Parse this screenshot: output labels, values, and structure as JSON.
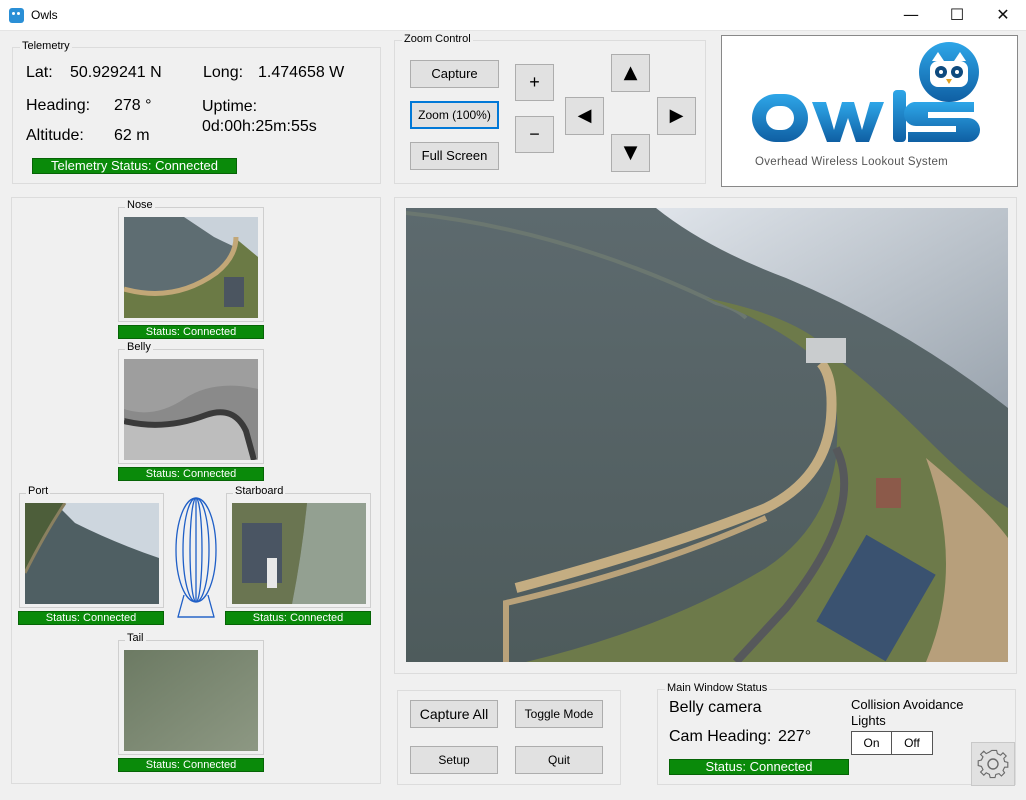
{
  "window": {
    "title": "Owls",
    "minimize_glyph": "—",
    "maximize_glyph": "☐",
    "close_glyph": "✕"
  },
  "telemetry": {
    "group_label": "Telemetry",
    "lat_label": "Lat:",
    "lat_value": "50.929241 N",
    "long_label": "Long:",
    "long_value": "1.474658 W",
    "heading_label": "Heading:",
    "heading_value": "278 °",
    "uptime_label": "Uptime:",
    "uptime_value": "0d:00h:25m:55s",
    "altitude_label": "Altitude:",
    "altitude_value": "62 m",
    "status": "Telemetry Status: Connected"
  },
  "zoom_control": {
    "group_label": "Zoom Control",
    "capture_label": "Capture",
    "zoom_label": "Zoom (100%)",
    "fullscreen_label": "Full Screen",
    "plus_label": "+",
    "minus_label": "−",
    "up_glyph": "▲",
    "down_glyph": "▼",
    "left_glyph": "◀",
    "right_glyph": "▶"
  },
  "logo": {
    "wordmark": "Owls",
    "tagline": "Overhead Wireless Lookout System"
  },
  "cameras": {
    "nose": {
      "label": "Nose",
      "status": "Status: Connected"
    },
    "belly": {
      "label": "Belly",
      "status": "Status: Connected"
    },
    "port": {
      "label": "Port",
      "status": "Status: Connected"
    },
    "starboard": {
      "label": "Starboard",
      "status": "Status: Connected"
    },
    "tail": {
      "label": "Tail",
      "status": "Status: Connected"
    }
  },
  "bottom_buttons": {
    "capture_all": "Capture All",
    "toggle_mode": "Toggle Mode",
    "setup": "Setup",
    "quit": "Quit"
  },
  "main_status": {
    "group_label": "Main Window Status",
    "camera_name": "Belly camera",
    "cam_heading_label": "Cam Heading:",
    "cam_heading_value": "227°",
    "status": "Status: Connected"
  },
  "collision_lights": {
    "title": "Collision Avoidance Lights",
    "on_label": "On",
    "off_label": "Off"
  },
  "colors": {
    "status_green": "#0a8a0a",
    "logo_blue": "#1a7fc9",
    "focus_blue": "#0078d7"
  }
}
